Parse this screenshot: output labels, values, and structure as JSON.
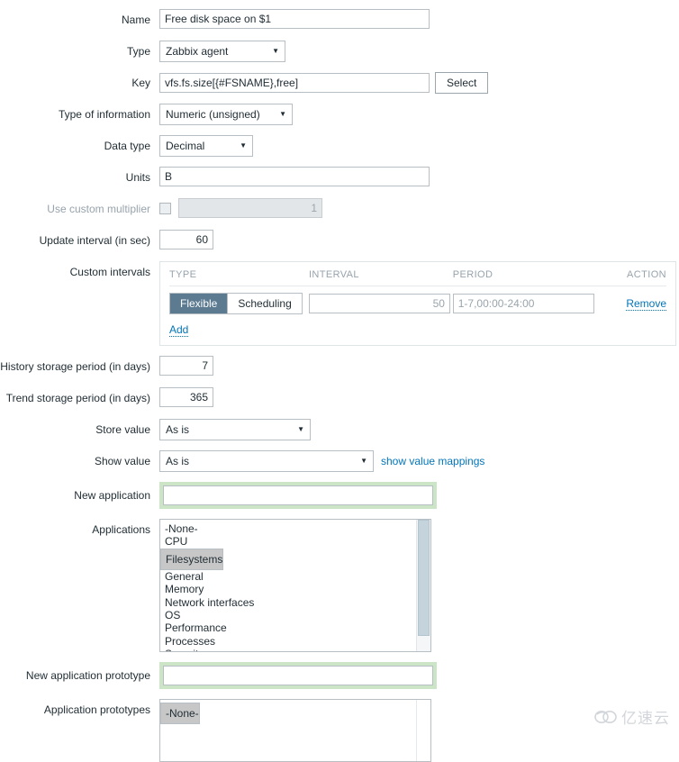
{
  "form": {
    "name": {
      "label": "Name",
      "value": "Free disk space on $1"
    },
    "type": {
      "label": "Type",
      "value": "Zabbix agent"
    },
    "key": {
      "label": "Key",
      "value": "vfs.fs.size[{#FSNAME},free]",
      "select_button": "Select"
    },
    "type_of_information": {
      "label": "Type of information",
      "value": "Numeric (unsigned)"
    },
    "data_type": {
      "label": "Data type",
      "value": "Decimal"
    },
    "units": {
      "label": "Units",
      "value": "B"
    },
    "custom_multiplier": {
      "label": "Use custom multiplier",
      "checked": false,
      "value": "1"
    },
    "update_interval": {
      "label": "Update interval (in sec)",
      "value": "60"
    },
    "custom_intervals": {
      "label": "Custom intervals",
      "columns": {
        "type": "TYPE",
        "interval": "INTERVAL",
        "period": "PERIOD",
        "action": "ACTION"
      },
      "rows": [
        {
          "type_options": [
            "Flexible",
            "Scheduling"
          ],
          "type_selected": "Flexible",
          "interval_value": "",
          "interval_placeholder": "50",
          "period_value": "",
          "period_placeholder": "1-7,00:00-24:00",
          "action": "Remove"
        }
      ],
      "add_label": "Add"
    },
    "history_storage": {
      "label": "History storage period (in days)",
      "value": "7"
    },
    "trend_storage": {
      "label": "Trend storage period (in days)",
      "value": "365"
    },
    "store_value": {
      "label": "Store value",
      "value": "As is"
    },
    "show_value": {
      "label": "Show value",
      "value": "As is",
      "mappings_link": "show value mappings"
    },
    "new_application": {
      "label": "New application",
      "value": "",
      "focused": true
    },
    "applications": {
      "label": "Applications",
      "options": [
        "-None-",
        "CPU",
        "Filesystems",
        "General",
        "Memory",
        "Network interfaces",
        "OS",
        "Performance",
        "Processes",
        "Security"
      ],
      "selected": [
        "Filesystems"
      ]
    },
    "new_application_prototype": {
      "label": "New application prototype",
      "value": "",
      "focused": true
    },
    "application_prototypes": {
      "label": "Application prototypes",
      "options": [
        "-None-"
      ],
      "selected": [
        "-None-"
      ]
    }
  },
  "watermark": {
    "text": "亿速云"
  },
  "colors": {
    "accent_link": "#0275b8",
    "segment_selected_bg": "#5c7b91",
    "focus_ring_green": "#cbe5c6",
    "list_selected_bg": "#c7c7c7",
    "border": "#b8bfc4"
  }
}
